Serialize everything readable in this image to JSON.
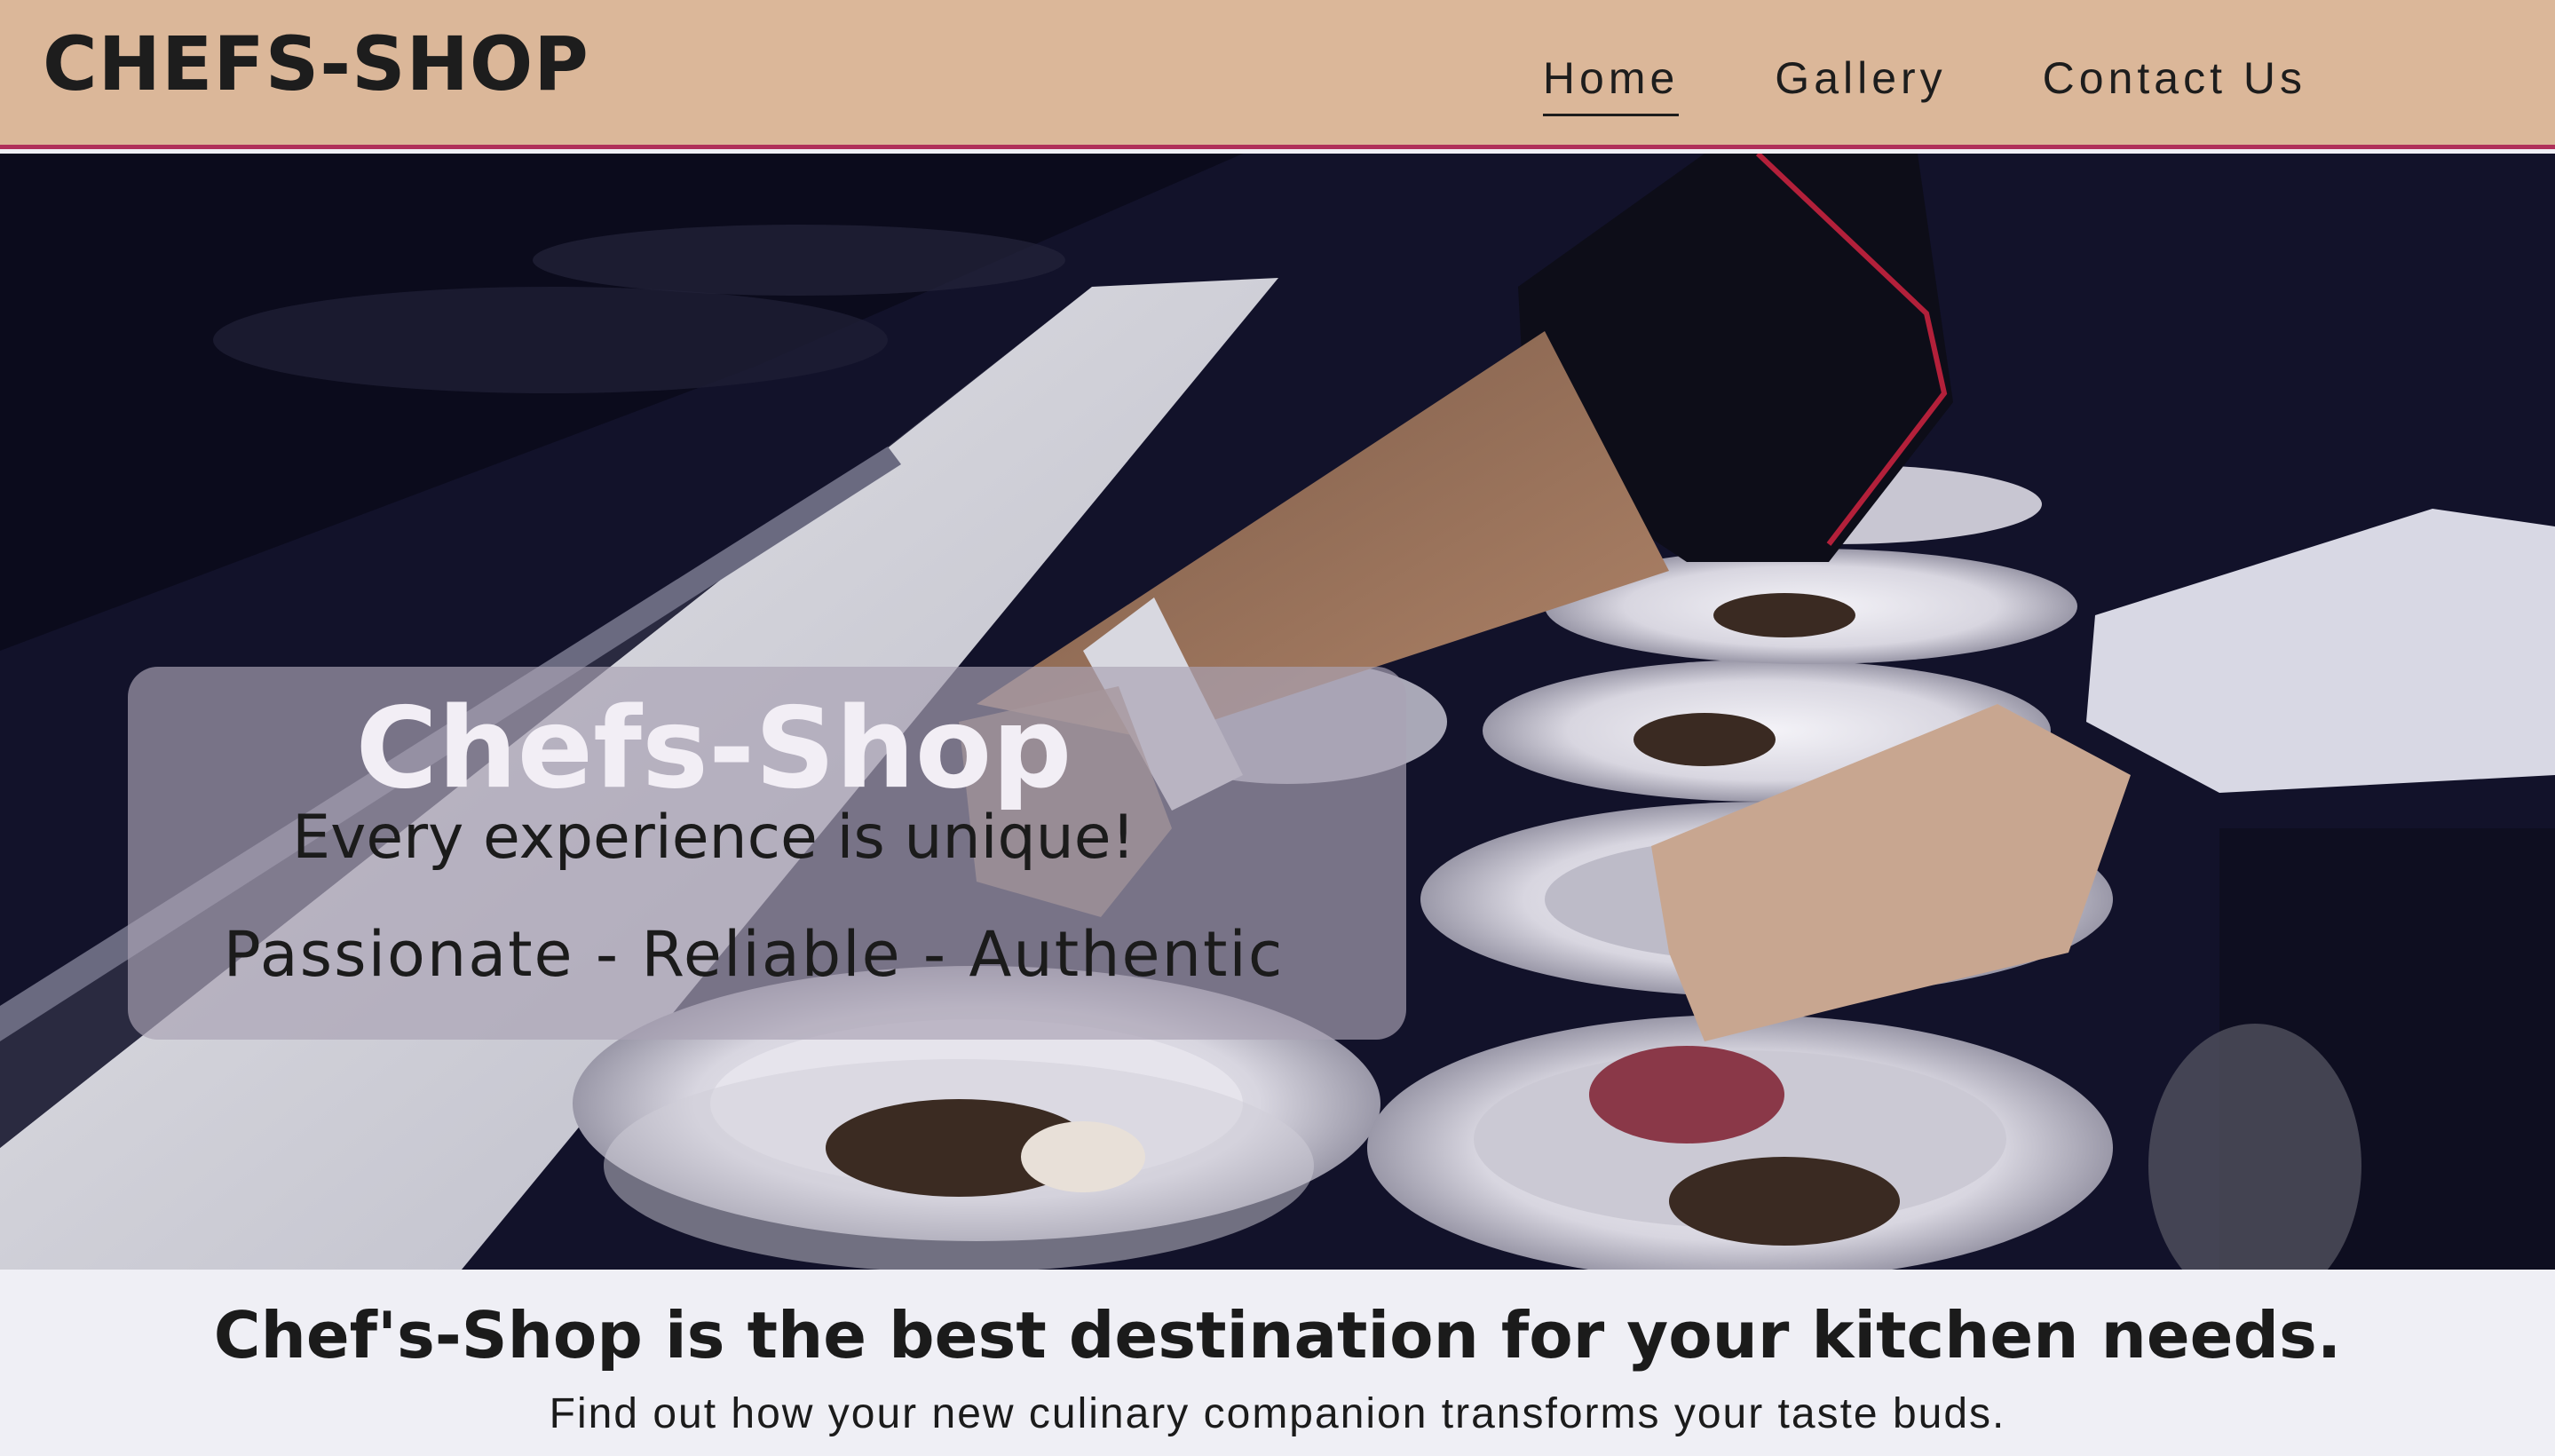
{
  "header": {
    "brand": "CHEFS-SHOP",
    "nav": [
      {
        "label": "Home",
        "active": true
      },
      {
        "label": "Gallery",
        "active": false
      },
      {
        "label": "Contact Us",
        "active": false
      }
    ]
  },
  "hero": {
    "title": "Chefs-Shop",
    "tagline": "Every experience is unique!",
    "values": "Passionate - Reliable - Authentic"
  },
  "intro": {
    "heading": "Chef's-Shop is the best destination for your kitchen needs.",
    "subheading": "Find out how your new culinary companion transforms your taste buds."
  },
  "colors": {
    "header_bg": "#dbb799",
    "header_border": "#b0305a",
    "page_bg": "#efeff5",
    "text": "#1b1b1b"
  }
}
